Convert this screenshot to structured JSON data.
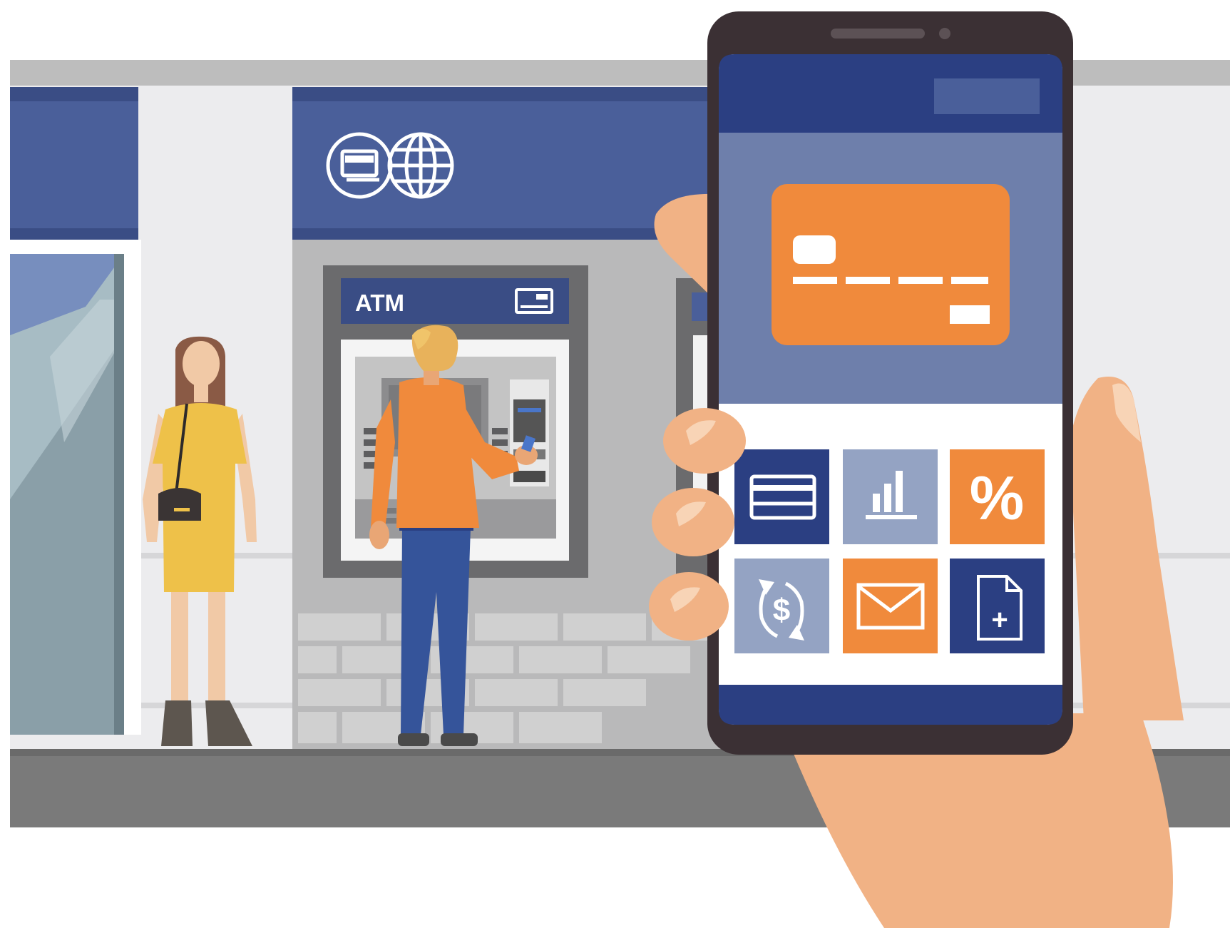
{
  "atm_sign": {
    "label": "ATM",
    "icon": "card-icon"
  },
  "bank_banner": {
    "icons": [
      "card-icon",
      "globe-icon"
    ]
  },
  "phone_app": {
    "card_icon": "credit-card-icon",
    "tiles": [
      {
        "name": "cards",
        "icon": "card-icon",
        "color": "#2b3f82"
      },
      {
        "name": "statistics",
        "icon": "bar-chart-icon",
        "color": "#94a3c3"
      },
      {
        "name": "interest",
        "icon": "percent-icon",
        "label": "%",
        "color": "#f08a3c"
      },
      {
        "name": "exchange",
        "icon": "dollar-exchange-icon",
        "label": "$",
        "color": "#94a3c3"
      },
      {
        "name": "messages",
        "icon": "envelope-icon",
        "color": "#f08a3c"
      },
      {
        "name": "new-document",
        "icon": "document-plus-icon",
        "label": "+",
        "color": "#2b3f82"
      }
    ]
  },
  "colors": {
    "navy": "#2b3f82",
    "banner_blue": "#4a5f9a",
    "orange": "#f08a3c",
    "skin": "#f1b285",
    "phone_body": "#3b3034",
    "card_area": "#6e7fab"
  }
}
